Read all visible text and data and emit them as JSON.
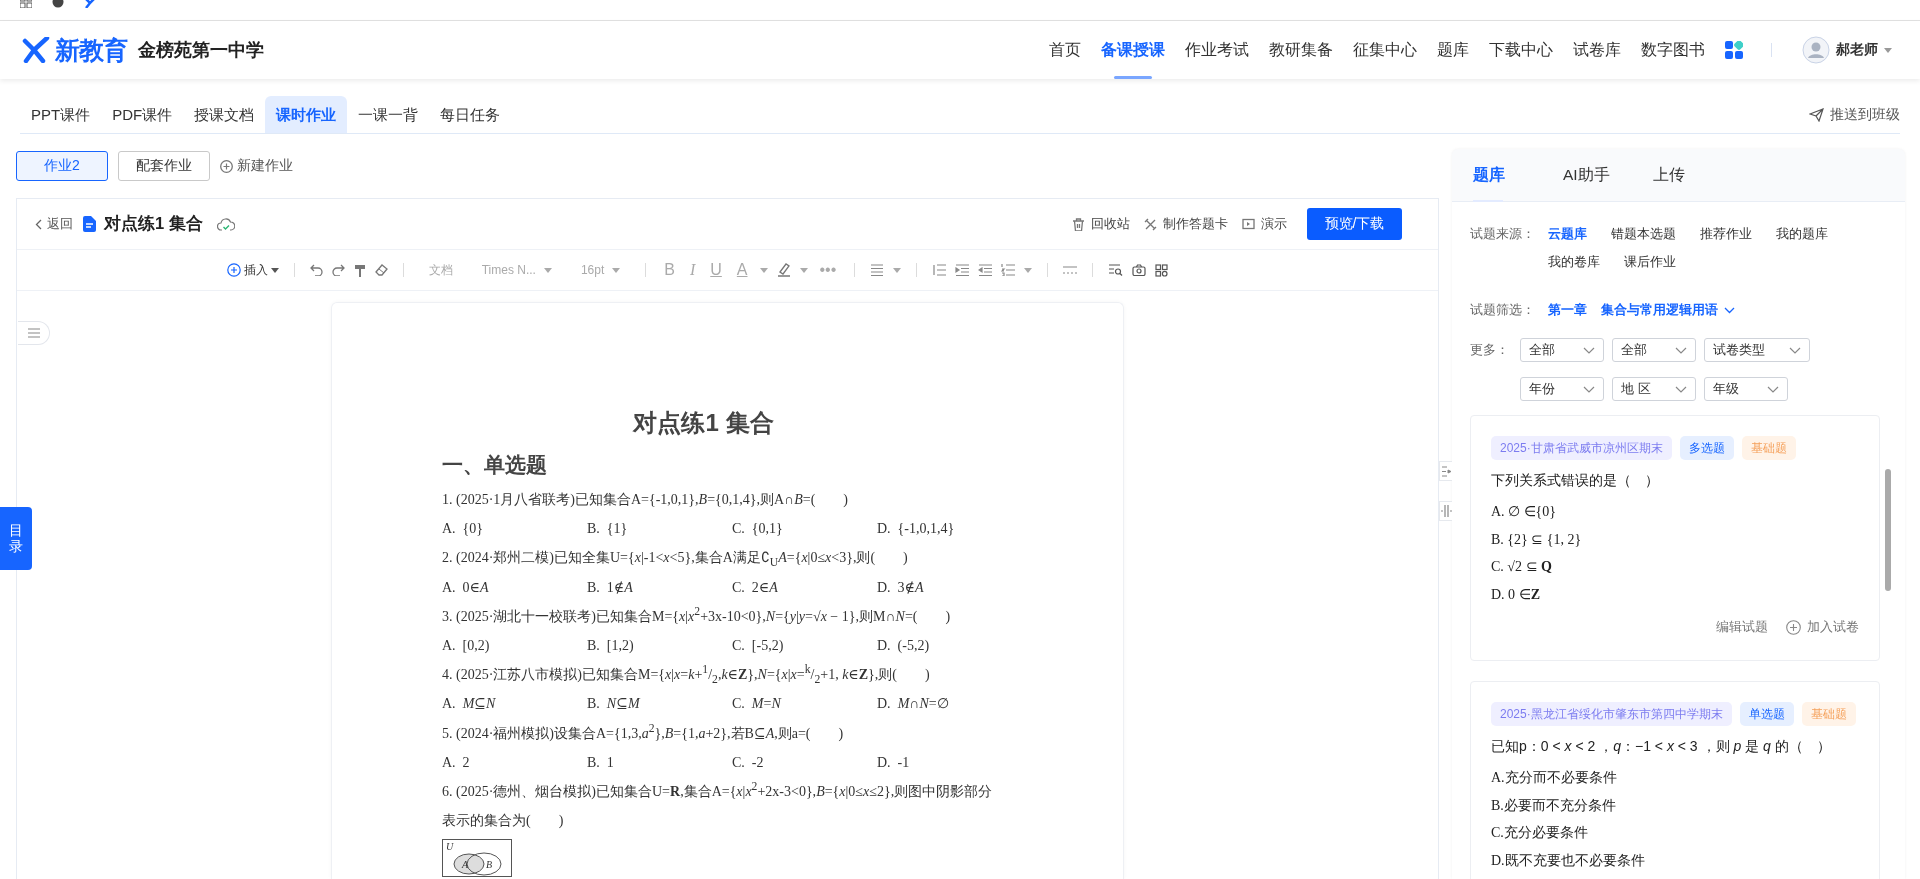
{
  "header": {
    "logo_text": "新教育",
    "school": "金榜苑第一中学",
    "nav": [
      {
        "label": "首页",
        "selected": false
      },
      {
        "label": "备课授课",
        "selected": true
      },
      {
        "label": "作业考试",
        "selected": false
      },
      {
        "label": "教研集备",
        "selected": false
      },
      {
        "label": "征集中心",
        "selected": false
      },
      {
        "label": "题库",
        "selected": false
      },
      {
        "label": "下载中心",
        "selected": false
      },
      {
        "label": "试卷库",
        "selected": false
      },
      {
        "label": "数字图书",
        "selected": false
      }
    ],
    "user": "郝老师"
  },
  "tabs": [
    {
      "label": "PPT课件",
      "selected": false
    },
    {
      "label": "PDF课件",
      "selected": false
    },
    {
      "label": "授课文档",
      "selected": false
    },
    {
      "label": "课时作业",
      "selected": true
    },
    {
      "label": "一课一背",
      "selected": false
    },
    {
      "label": "每日任务",
      "selected": false
    }
  ],
  "push_button": "推送到班级",
  "homework_tabs": [
    {
      "label": "作业2",
      "selected": true
    },
    {
      "label": "配套作业",
      "selected": false
    }
  ],
  "new_homework": "新建作业",
  "editor": {
    "back": "返回",
    "title": "对点练1 集合",
    "actions": [
      "回收站",
      "制作答题卡",
      "演示"
    ],
    "primary": "预览/下载",
    "toc": "目录",
    "toolbar": {
      "insert": "插入",
      "style": "文档",
      "font": "Times N...",
      "size": "16pt",
      "format": [
        "B",
        "I",
        "U",
        "A"
      ],
      "more": "•••"
    }
  },
  "document": {
    "title": "对点练1 集合",
    "section": "一、单选题",
    "items": [
      {
        "kind": "question",
        "text": "1. (2025·1月八省联考)已知集合A={-1,0,1},*B*={0,1,4},则A∩*B*=(　　)"
      },
      {
        "kind": "options",
        "options": [
          "A.  {0}",
          "B.  {1}",
          "C.  {0,1}",
          "D.  {-1,0,1,4}"
        ]
      },
      {
        "kind": "question",
        "text": "2. (2024·郑州二模)已知全集U={*x*|-1<*x*<5},集合A满足∁$_{U}$*A*={*x*|0≤*x*<3},则(　　)"
      },
      {
        "kind": "options",
        "options": [
          "A.  0∈*A*",
          "B.  1∉*A*",
          "C.  2∈*A*",
          "D.  3∉*A*"
        ]
      },
      {
        "kind": "question",
        "text": "3. (2025·湖北十一校联考)已知集合M={*x*|*x*$^{2}$+3x-10<0},*N*={*y*|*y*=√*x* − 1},则M∩*N*=(　　)"
      },
      {
        "kind": "options",
        "options": [
          "A.  [0,2)",
          "B.  [1,2)",
          "C.  [-5,2)",
          "D.  (-5,2)"
        ]
      },
      {
        "kind": "question",
        "text": "4. (2025·江苏八市模拟)已知集合M={*x*|*x*=*k*+$^{1}$/$_{2}$,*k*∈**Z**},*N*={*x*|*x*=$^{k}$/$_{2}$+1, *k*∈**Z**},则(　　)"
      },
      {
        "kind": "options",
        "options": [
          "A.  *M*⊆*N*",
          "B.  *N*⊆*M*",
          "C.  *M*=*N*",
          "D.  *M*∩*N*=∅"
        ]
      },
      {
        "kind": "question",
        "text": "5. (2024·福州模拟)设集合A={1,3,*a*$^{2}$},*B*={1,*a*+2},若B⊆*A*,则a=(　　)"
      },
      {
        "kind": "options",
        "options": [
          "A.  2",
          "B.  1",
          "C.  -2",
          "D.  -1"
        ]
      },
      {
        "kind": "question",
        "text": "6. (2025·德州、烟台模拟)已知集合U=**R**,集合A={*x*|*x*$^{2}$+2x-3<0},*B*={*x*|0≤*x*≤2},则图中阴影部分表示的集合为(　　)"
      },
      {
        "kind": "figure",
        "labels": [
          "U",
          "A",
          "B"
        ]
      }
    ]
  },
  "panel": {
    "tabs": [
      {
        "label": "题库",
        "selected": true
      },
      {
        "label": "AI助手",
        "selected": false
      },
      {
        "label": "上传",
        "selected": false
      }
    ],
    "source_label": "试题来源：",
    "sources": [
      {
        "label": "云题库",
        "selected": true
      },
      {
        "label": "错题本选题",
        "selected": false
      },
      {
        "label": "推荐作业",
        "selected": false
      },
      {
        "label": "我的题库",
        "selected": false
      },
      {
        "label": "我的卷库",
        "selected": false
      },
      {
        "label": "课后作业",
        "selected": false
      }
    ],
    "filter_label": "试题筛选：",
    "chapter": "第一章",
    "topic": "集合与常用逻辑用语",
    "more_label": "更多：",
    "dropdowns": [
      [
        "全部",
        "全部",
        "试卷类型"
      ],
      [
        "年份",
        "地 区",
        "年级"
      ]
    ],
    "cards": [
      {
        "source": "2025·甘肃省武威市凉州区期末",
        "type": "多选题",
        "level": "基础题",
        "stem": "下列关系式错误的是（　）",
        "options": [
          "A. ∅ ∈{0}",
          "B. {2} ⊆ {1, 2}",
          "C. √2 ⊆ **Q**",
          "D. 0 ∈**Z**"
        ],
        "edit": "编辑试题",
        "add": "加入试卷"
      },
      {
        "source": "2025·黑龙江省绥化市肇东市第四中学期末",
        "type": "单选题",
        "level": "基础题",
        "stem": "已知p：0 < *x* < 2 ，*q*：−1 < *x* < 3 ，则 *p* 是 *q* 的（　）",
        "options": [
          "A.充分而不必要条件",
          "B.必要而不充分条件",
          "C.充分必要条件",
          "D.既不充要也不必要条件"
        ]
      }
    ]
  }
}
